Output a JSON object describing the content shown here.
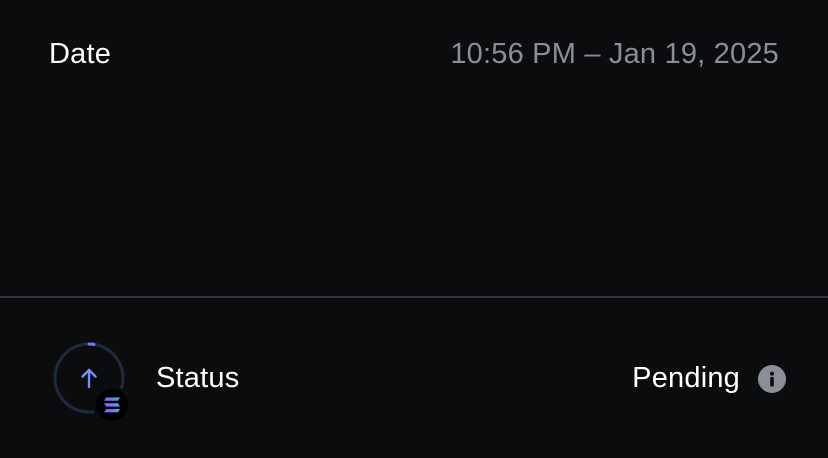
{
  "date": {
    "label": "Date",
    "value": "10:56 PM – Jan 19, 2025"
  },
  "status": {
    "label": "Status",
    "value": "Pending",
    "direction_icon": "arrow-up-icon",
    "token_icon": "solana-icon",
    "info_icon": "info-icon"
  },
  "colors": {
    "background": "#0b0c0e",
    "primary_text": "#ffffff",
    "secondary_text": "#8b8e94",
    "divider": "#34363b",
    "accent": "#6b7cff"
  }
}
